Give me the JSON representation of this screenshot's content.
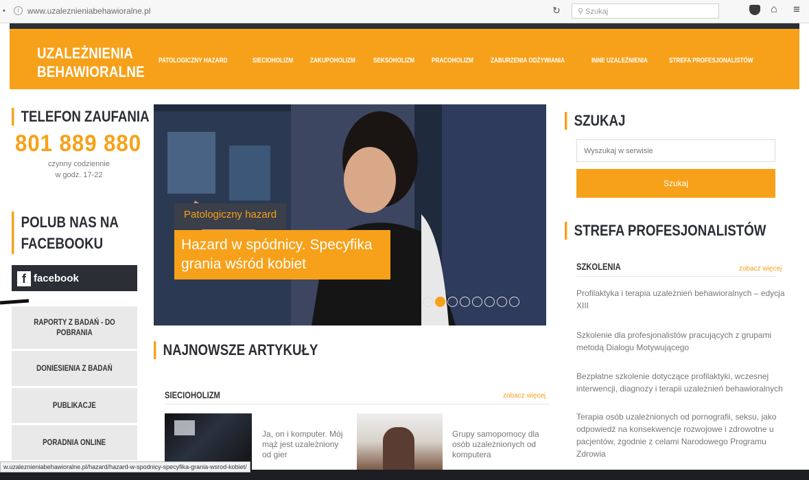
{
  "browser": {
    "url": "www.uzaleznieniabehawioralne.pl",
    "search_placeholder": "Szukaj"
  },
  "logo": {
    "line1": "UZALEŻNIENIA",
    "line2": "BEHAWIORALNE"
  },
  "mainnav": [
    "PATOLOGICZNY HAZARD",
    "SIECIOHOLIZM",
    "ZAKUPOHOLIZM",
    "SEKSOHOLIZM",
    "PRACOHOLIZM",
    "ZABURZENIA ODŻYWIANIA",
    "INNE UZALEŻNIENIA",
    "STREFA PROFESJONALISTÓW"
  ],
  "phone": {
    "title": "TELEFON ZAUFANIA",
    "number": "801 889 880",
    "hours_line1": "czynny codziennie",
    "hours_line2": "w godz. 17-22"
  },
  "facebook": {
    "title": "POLUB NAS NA FACEBOOKU",
    "button_label": "facebook"
  },
  "leftmenu": [
    "RAPORTY Z BADAŃ - DO POBRANIA",
    "DONIESIENIA Z BADAŃ",
    "PUBLIKACJE",
    "PORADNIA ONLINE"
  ],
  "slider": {
    "category": "Patologiczny hazard",
    "title": "Hazard w spódnicy. Specyfika grania wśród kobiet",
    "dot_count": 8,
    "active_dot": 2
  },
  "articles": {
    "heading": "NAJNOWSZE ARTYKUŁY",
    "section_label": "SIECIOHOLIZM",
    "more_label": "zobacz więcej",
    "items": [
      "Ja, on i komputer. Mój mąż jest uzależniony od gier",
      "Grupy samopomocy dla osób uzależnionych od komputera"
    ]
  },
  "search": {
    "heading": "SZUKAJ",
    "placeholder": "Wyszukaj w serwisie",
    "button_label": "Szukaj"
  },
  "professionals": {
    "heading": "STREFA PROFESJONALISTÓW",
    "section_label": "SZKOLENIA",
    "more_label": "zobacz więcej",
    "items": [
      "Profilaktyka i terapia uzależnień behawioralnych – edycja XIII",
      "Szkolenie dla profesjonalistów pracujących z grupami metodą Dialogu Motywującego",
      "Bezpłatne szkolenie dotyczące profilaktyki, wczesnej interwencji, diagnozy i terapii uzależnień behawioralnych",
      "Terapia osób uzależnionych od pornografii, seksu, jako odpowiedź na konsekwencje rozwojowe i zdrowotne u pacjentów, zgodnie z celami Narodowego Programu Zdrowia"
    ]
  },
  "status_url": "w.uzaleznieniabehawioralne.pl/hazard/hazard-w-spodnicy-specyfika-grania-wsrod-kobiet/",
  "colors": {
    "accent": "#f7a11a",
    "dark": "#2c2e36"
  }
}
